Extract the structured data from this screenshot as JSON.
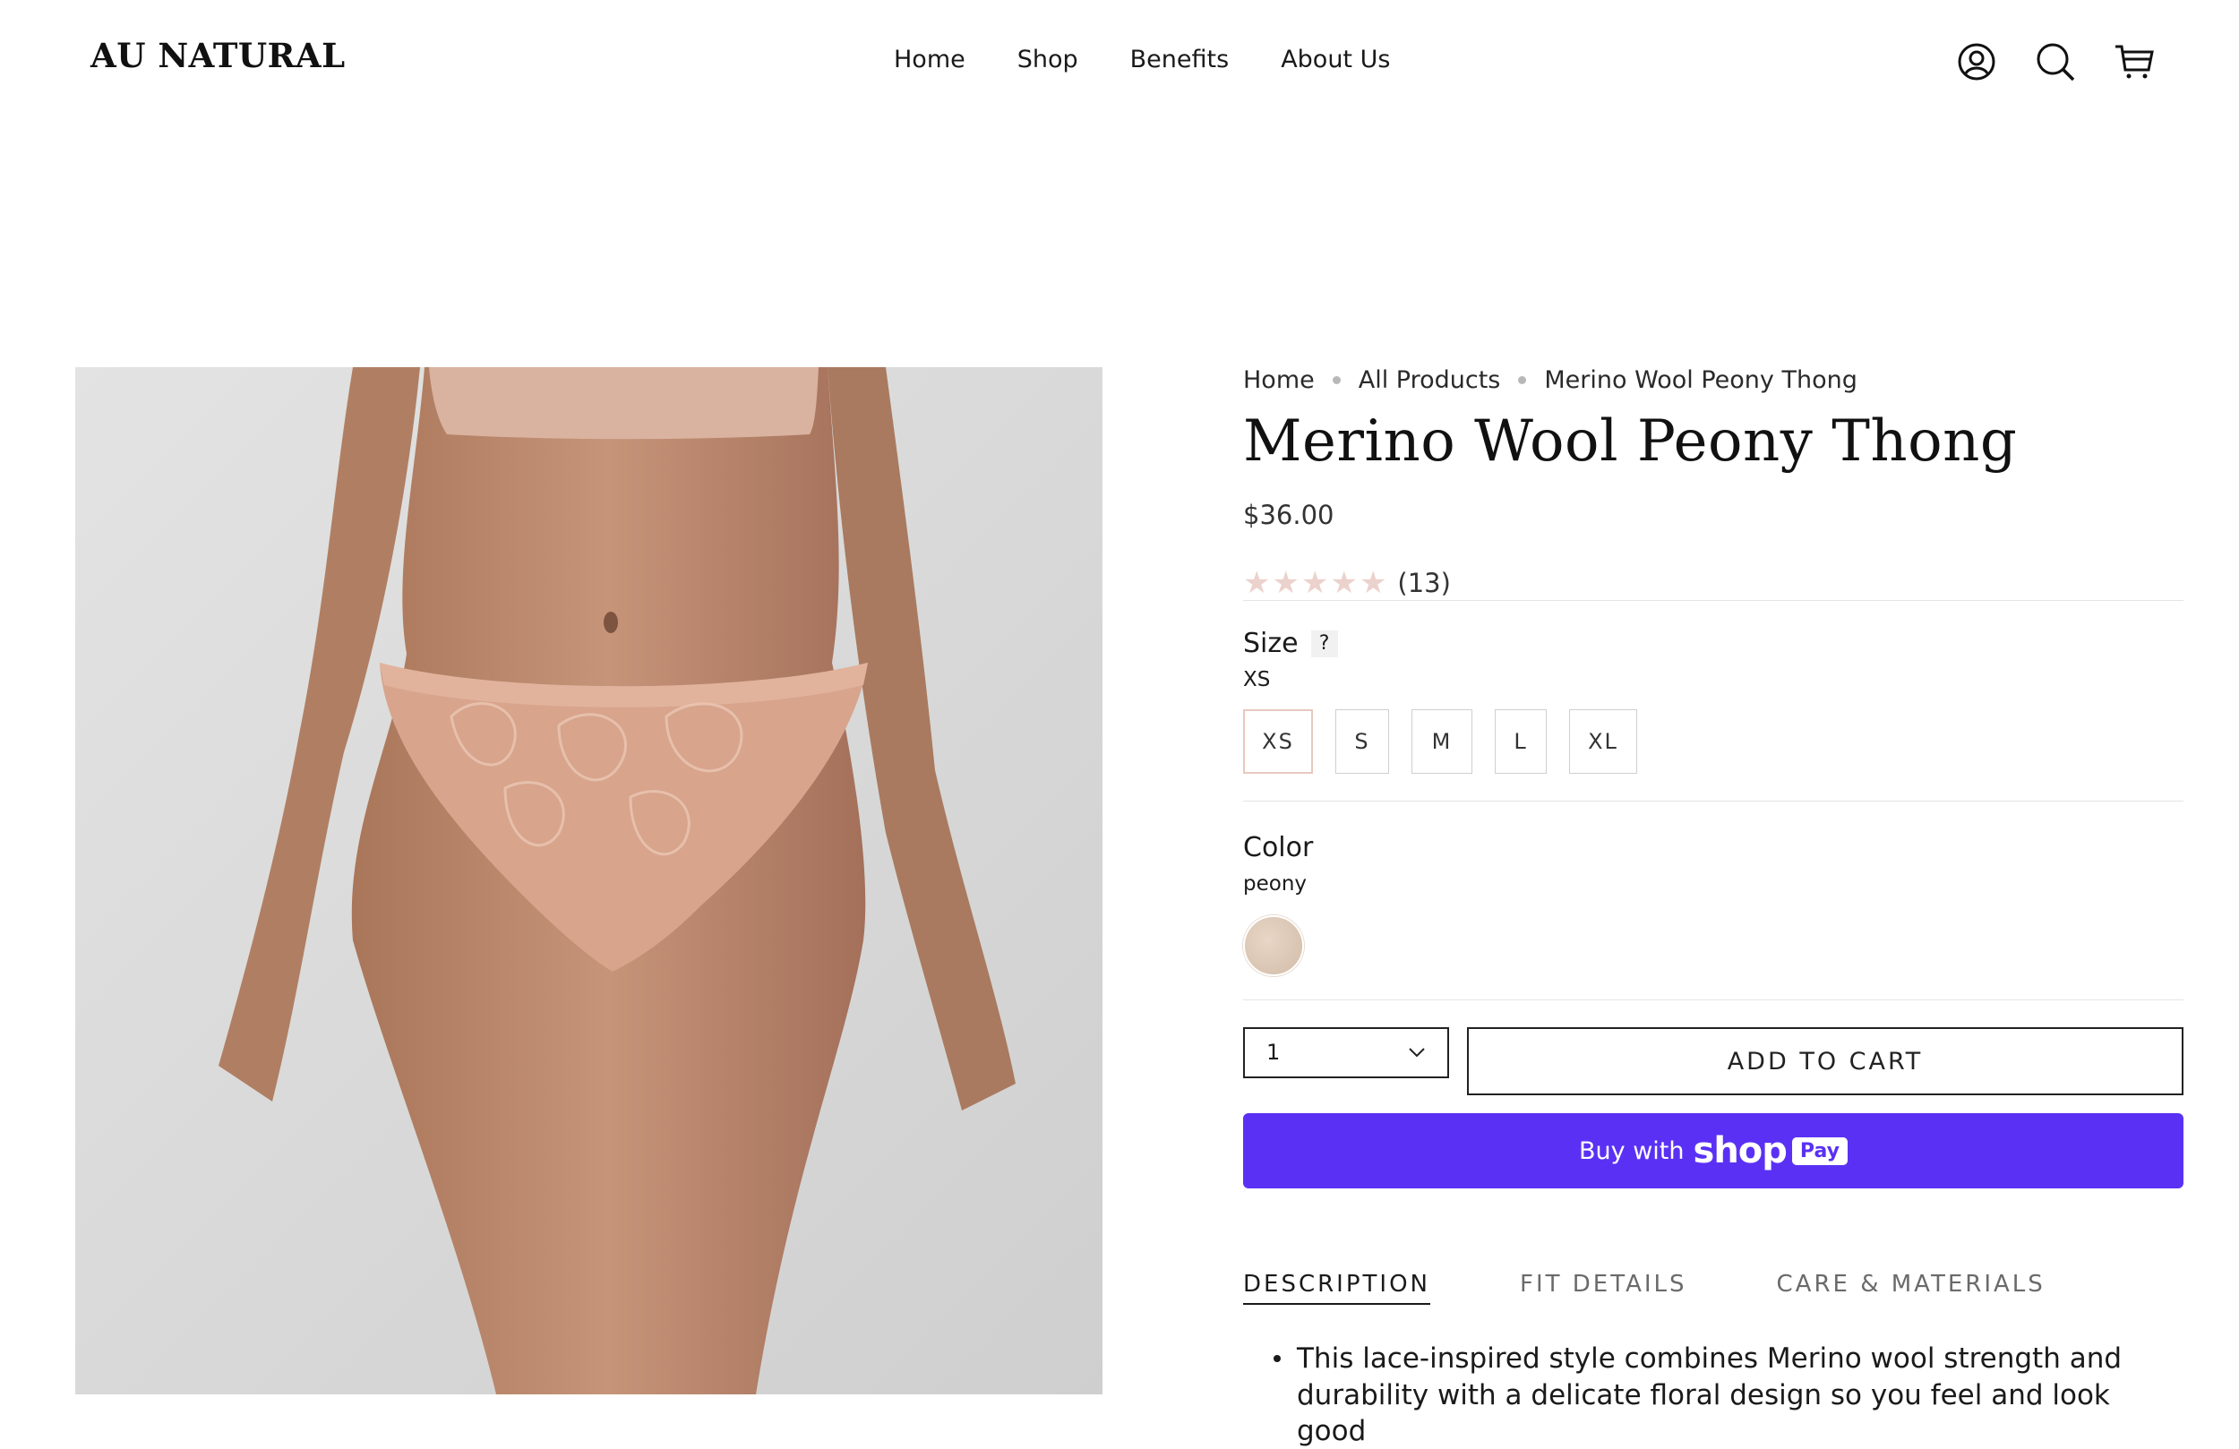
{
  "header": {
    "logo": "AU NATURAL",
    "nav": [
      "Home",
      "Shop",
      "Benefits",
      "About Us"
    ],
    "icons": [
      "account-icon",
      "search-icon",
      "cart-icon"
    ]
  },
  "breadcrumb": [
    "Home",
    "All Products",
    "Merino Wool Peony Thong"
  ],
  "product": {
    "title": "Merino Wool Peony Thong",
    "price": "$36.00",
    "rating_count": "(13)",
    "size_label": "Size",
    "size_help": "?",
    "selected_size": "XS",
    "sizes": [
      "XS",
      "S",
      "M",
      "L",
      "XL"
    ],
    "color_label": "Color",
    "selected_color": "peony",
    "quantity": "1",
    "add_to_cart": "ADD TO CART",
    "shop_pay": {
      "buy": "Buy with",
      "shop": "shop",
      "pay": "Pay"
    }
  },
  "tabs": [
    "DESCRIPTION",
    "FIT DETAILS",
    "CARE & MATERIALS"
  ],
  "description": "This lace-inspired style combines Merino wool strength and durability with a delicate floral design so you feel and look good",
  "colors": {
    "shop_pay": "#5a31f4",
    "swatch": "#e2d0bf"
  }
}
